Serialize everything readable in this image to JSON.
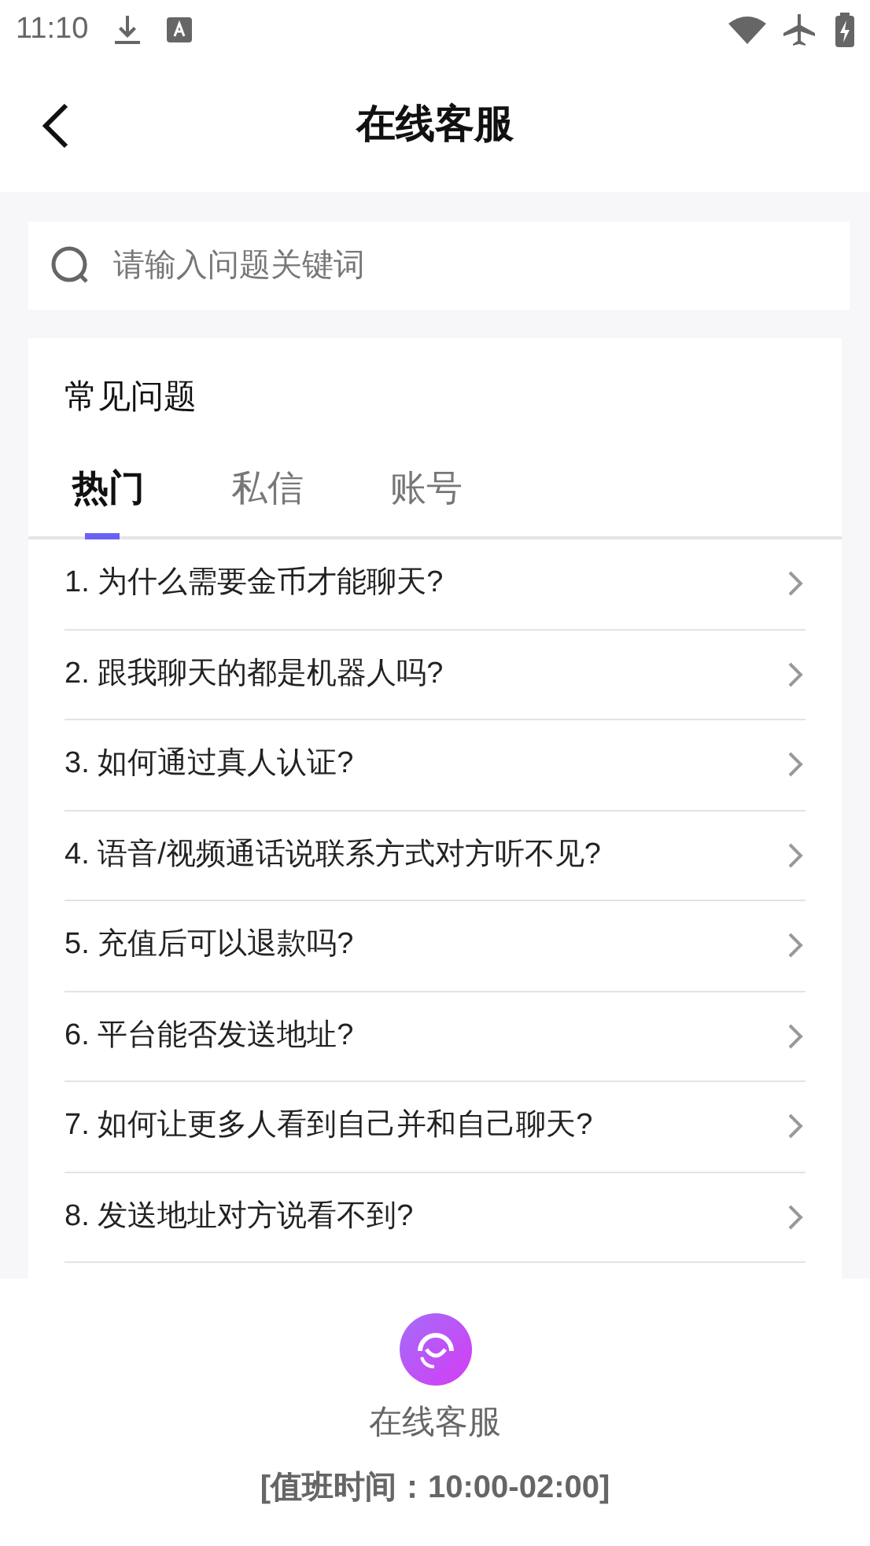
{
  "status_bar": {
    "time": "11:10"
  },
  "header": {
    "title": "在线客服"
  },
  "search": {
    "placeholder": "请输入问题关键词"
  },
  "faq": {
    "title": "常见问题",
    "tabs": [
      {
        "label": "热门",
        "selected": true
      },
      {
        "label": "私信",
        "selected": false
      },
      {
        "label": "账号",
        "selected": false
      }
    ],
    "questions": [
      "1. 为什么需要金币才能聊天?",
      "2. 跟我聊天的都是机器人吗?",
      "3. 如何通过真人认证?",
      "4. 语音/视频通话说联系方式对方听不见?",
      "5. 充值后可以退款吗?",
      "6. 平台能否发送地址?",
      "7. 如何让更多人看到自己并和自己聊天?",
      "8. 发送地址对方说看不到?"
    ]
  },
  "support": {
    "label": "在线客服",
    "hours": "[值班时间：10:00-02:00]"
  }
}
